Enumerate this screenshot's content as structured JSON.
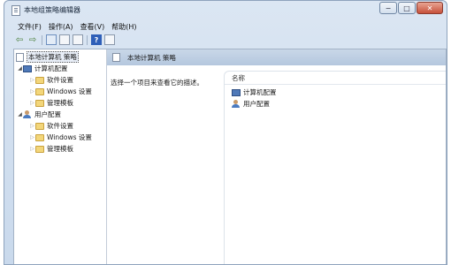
{
  "window": {
    "title": "本地组策略编辑器",
    "buttons": {
      "minimize": "−",
      "maximize": "□",
      "close": "✕"
    }
  },
  "menu": [
    "文件(F)",
    "操作(A)",
    "查看(V)",
    "帮助(H)"
  ],
  "toolbar": {
    "icons": [
      "back-icon",
      "forward-icon",
      "show-tree-icon",
      "list-icon",
      "export-icon",
      "help-icon",
      "properties-icon"
    ],
    "help_glyph": "?"
  },
  "tree": {
    "root": "本地计算机 策略",
    "computer": {
      "label": "计算机配置",
      "children": [
        "软件设置",
        "Windows 设置",
        "管理模板"
      ]
    },
    "user": {
      "label": "用户配置",
      "children": [
        "软件设置",
        "Windows 设置",
        "管理模板"
      ]
    }
  },
  "right": {
    "header_title": "本地计算机 策略",
    "description": "选择一个项目来查看它的描述。",
    "column_name": "名称",
    "items": [
      "计算机配置",
      "用户配置"
    ]
  },
  "colors": {
    "title_gradient_top": "#dbe6f3",
    "header_band": "#c9d7e8",
    "folder": "#f3d67a"
  }
}
